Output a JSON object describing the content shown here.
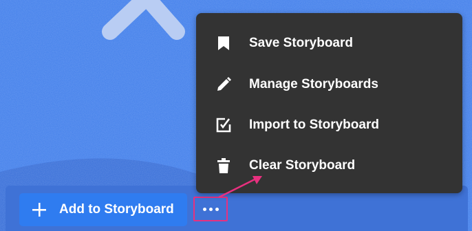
{
  "menu": {
    "items": [
      {
        "label": "Save Storyboard",
        "icon": "bookmark-icon"
      },
      {
        "label": "Manage Storyboards",
        "icon": "pencil-icon"
      },
      {
        "label": "Import to Storyboard",
        "icon": "import-checkbox-icon"
      },
      {
        "label": "Clear Storyboard",
        "icon": "trash-icon"
      }
    ]
  },
  "toolbar": {
    "add_label": "Add to Storyboard",
    "add_icon": "plus-icon",
    "more_icon": "more-dots-icon"
  },
  "colors": {
    "background": "#3a78e6",
    "menu_background": "#333333",
    "add_button": "#2f7cf0",
    "highlight": "#e8307f"
  }
}
